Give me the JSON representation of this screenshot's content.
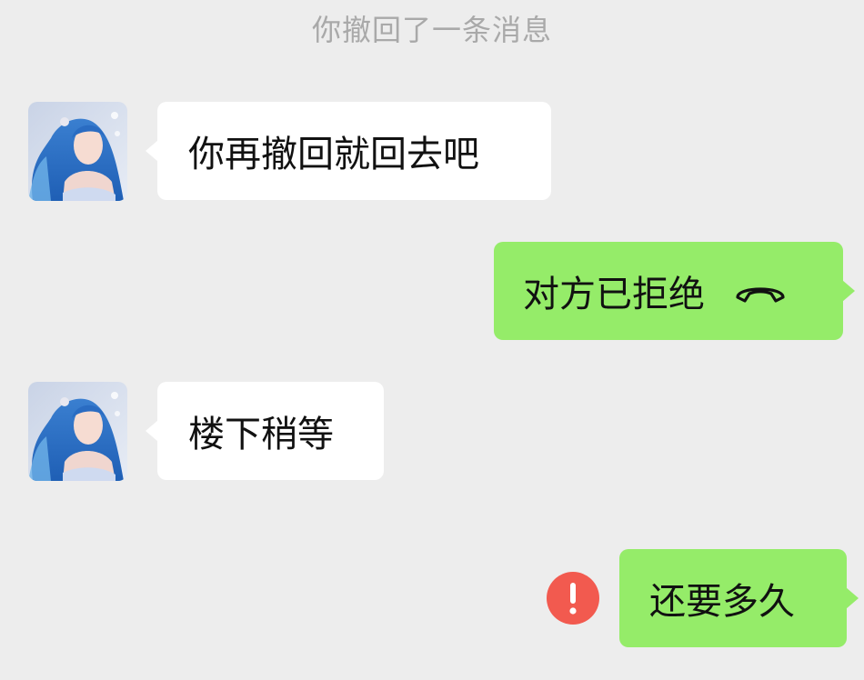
{
  "system_notice": "你撤回了一条消息",
  "messages": [
    {
      "side": "in",
      "text": "你再撤回就回去吧",
      "avatar": "contact-avatar"
    },
    {
      "side": "out",
      "text": "对方已拒绝",
      "icon": "phone-hangup-icon"
    },
    {
      "side": "in",
      "text": "楼下稍等",
      "avatar": "contact-avatar"
    },
    {
      "side": "out",
      "text": "还要多久",
      "status": "send-failed",
      "status_icon": "exclamation-icon"
    }
  ],
  "colors": {
    "background": "#ededed",
    "incoming_bubble": "#ffffff",
    "outgoing_bubble": "#95ec69",
    "error": "#f25a4f"
  }
}
